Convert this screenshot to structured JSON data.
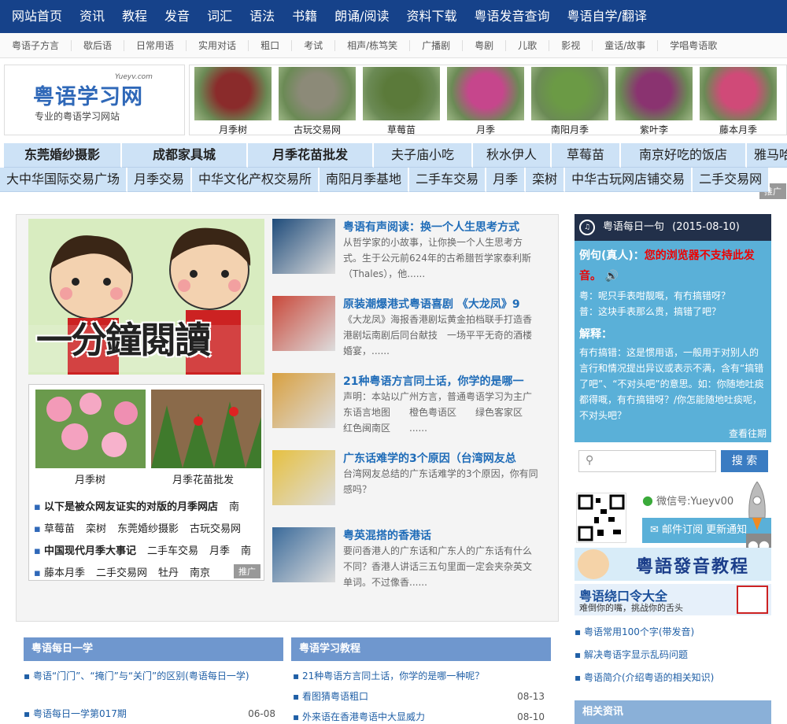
{
  "nav": [
    "网站首页",
    "资讯",
    "教程",
    "发音",
    "词汇",
    "语法",
    "书籍",
    "朗诵/阅读",
    "资料下载",
    "粤语发音查询",
    "粤语自学/翻译"
  ],
  "subnav": [
    "粤语子方言",
    "歇后语",
    "日常用语",
    "实用对话",
    "粗口",
    "考试",
    "相声/栋笃笑",
    "广播剧",
    "粤剧",
    "儿歌",
    "影视",
    "童话/故事",
    "学唱粤语歌"
  ],
  "logo": {
    "site": "Yueyv.com",
    "name": "粤语学习网",
    "slogan": "专业的粤语学习网站"
  },
  "ads": {
    "images": [
      {
        "label": "月季树",
        "color": "#8a2b2b"
      },
      {
        "label": "古玩交易网",
        "color": "#8c8a78"
      },
      {
        "label": "草莓苗",
        "color": "#5b7a3a"
      },
      {
        "label": "月季",
        "color": "#c6468c"
      },
      {
        "label": "南阳月季",
        "color": "#6b9a45"
      },
      {
        "label": "紫叶李",
        "color": "#8a3370"
      },
      {
        "label": "藤本月季",
        "color": "#d04a78"
      }
    ],
    "tag": "推广"
  },
  "keywords1": [
    "东莞婚纱摄影",
    "成都家具城",
    "月季花苗批发",
    "夫子庙小吃",
    "秋水伊人",
    "草莓苗",
    "南京好吃的饭店",
    "雅马哈钢琴"
  ],
  "keywords2": [
    "大中华国际交易广场",
    "月季交易",
    "中华文化产权交易所",
    "南阳月季基地",
    "二手车交易",
    "月季",
    "栾树",
    "中华古玩网店铺交易",
    "二手交易网"
  ],
  "feature": {
    "text": "一分鐘閱讀"
  },
  "flowers": [
    {
      "label": "月季树"
    },
    {
      "label": "月季花苗批发"
    }
  ],
  "adlinks": [
    [
      "以下是被众网友证实的对版的月季网店",
      "南"
    ],
    [
      "草莓苗",
      "栾树",
      "东莞婚纱摄影",
      "古玩交易网"
    ],
    [
      "中国现代月季大事记",
      "二手车交易",
      "月季",
      "南"
    ],
    [
      "藤本月季",
      "二手交易网",
      "牡丹",
      "南京"
    ]
  ],
  "adlink_tag": "推广",
  "news": [
    {
      "title": "粤语有声阅读：换一个人生思考方式",
      "desc": "从哲学家的小故事，让你换一个人生思考方式。生于公元前624年的古希腊哲学家泰利斯（Thales），他......"
    },
    {
      "title": "原装潮爆港式粤语喜剧 《大龙凤》9",
      "desc": "《大龙凤》海报香港剧坛黄金拍档联手打造香港剧坛南剧后同台献技　一场平平无奇的酒楼婚宴，......"
    },
    {
      "title": "21种粤语方言同土话，你学的是哪一",
      "desc": "声明：本站以广州方言，普通粤语学习为主广东语言地图　　橙色粤语区　　绿色客家区　　红色闽南区　　......"
    },
    {
      "title": "广东话难学的3个原因（台湾网友总",
      "desc": "台湾网友总结的广东话难学的3个原因，你有同感吗？"
    },
    {
      "title": "粤英混搭的香港话",
      "desc": "要问香港人的广东话和广东人的广东话有什么不同？香港人讲话三五句里面一定会夹杂英文单词。不过像香......"
    }
  ],
  "daily": {
    "title": "粤语每日一句",
    "date": "(2015-08-10)",
    "example_label": "例句(真人)：",
    "warning": "您的浏览器不支持此发音。",
    "yue": "粤：呢只手表咁靓嘅，有冇搞错呀？",
    "pu": "普：这块手表那么贵，搞错了吧？",
    "explain_label": "解释：",
    "explain": "有冇搞错：这是惯用语，一般用于对别人的言行和情况提出异议或表示不满，含有“搞错了吧”、“不对头吧”的意思。如：你随地吐痰都得嘅，有冇搞错呀？/你怎能随地吐痰呢，不对头吧？",
    "more": "查看往期"
  },
  "search": {
    "placeholder": "",
    "button": "搜 索"
  },
  "wechat": {
    "label": "微信号:Yueyv00",
    "subscribe": "邮件订阅 更新通知"
  },
  "banners": [
    {
      "text": "粵語發音教程"
    },
    {
      "text": "粤语绕口令大全",
      "sub": "难倒你的嘴，挑战你的舌头"
    }
  ],
  "rlinks": [
    "粤语常用100个字(带发音)",
    "解决粤语字显示乱码问题",
    "粤语简介(介绍粤语的相关知识)"
  ],
  "related": "相关资讯",
  "col1": {
    "title": "粤语每日一学",
    "items": [
      {
        "text": "粤语“门门”、“掩门”与“关门”的区别(粤语每日一学)",
        "date": ""
      },
      {
        "text": "粤语每日一学第017期",
        "date": "06-08"
      }
    ]
  },
  "col2": {
    "title": "粤语学习教程",
    "items": [
      {
        "text": "21种粤语方言同土话，你学的是哪一种呢？",
        "date": ""
      },
      {
        "text": "看图猜粤语粗口",
        "date": "08-13"
      },
      {
        "text": "外来语在香港粤语中大显威力",
        "date": "08-10"
      }
    ]
  }
}
